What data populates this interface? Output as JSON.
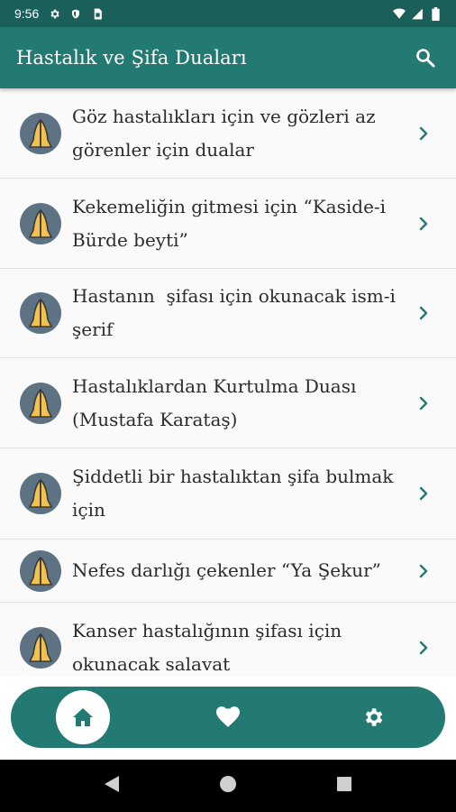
{
  "status_bar": {
    "time": "9:56"
  },
  "app_bar": {
    "title": "Hastalık ve Şifa Duaları"
  },
  "items": [
    {
      "title": "Göz hastalıkları için ve gözleri az görenler için dualar"
    },
    {
      "title": "Kekemeliğin gitmesi için “Kaside-i Bürde beyti”"
    },
    {
      "title": "Hastanın  şifası için okunacak ism-i şerif"
    },
    {
      "title": "Hastalıklardan Kurtulma Duası (Mustafa Karataş)"
    },
    {
      "title": "Şiddetli bir hastalıktan şifa bulmak için"
    },
    {
      "title": "Nefes darlığı çekenler “Ya Şekur”"
    },
    {
      "title": "Kanser hastalığının şifası için okunacak salavat"
    }
  ],
  "colors": {
    "status_bar": "#1b5f5a",
    "primary": "#237a72",
    "chevron": "#237a72",
    "avatar_bg": "#5d7384",
    "hands": "#f2c14e"
  },
  "icons": {
    "search": "search-icon",
    "praying_hands": "praying-hands-icon",
    "chevron": "chevron-right-icon",
    "home": "home-icon",
    "favorites": "heart-icon",
    "settings": "gear-icon"
  },
  "bottom_nav": {
    "active": "home"
  }
}
